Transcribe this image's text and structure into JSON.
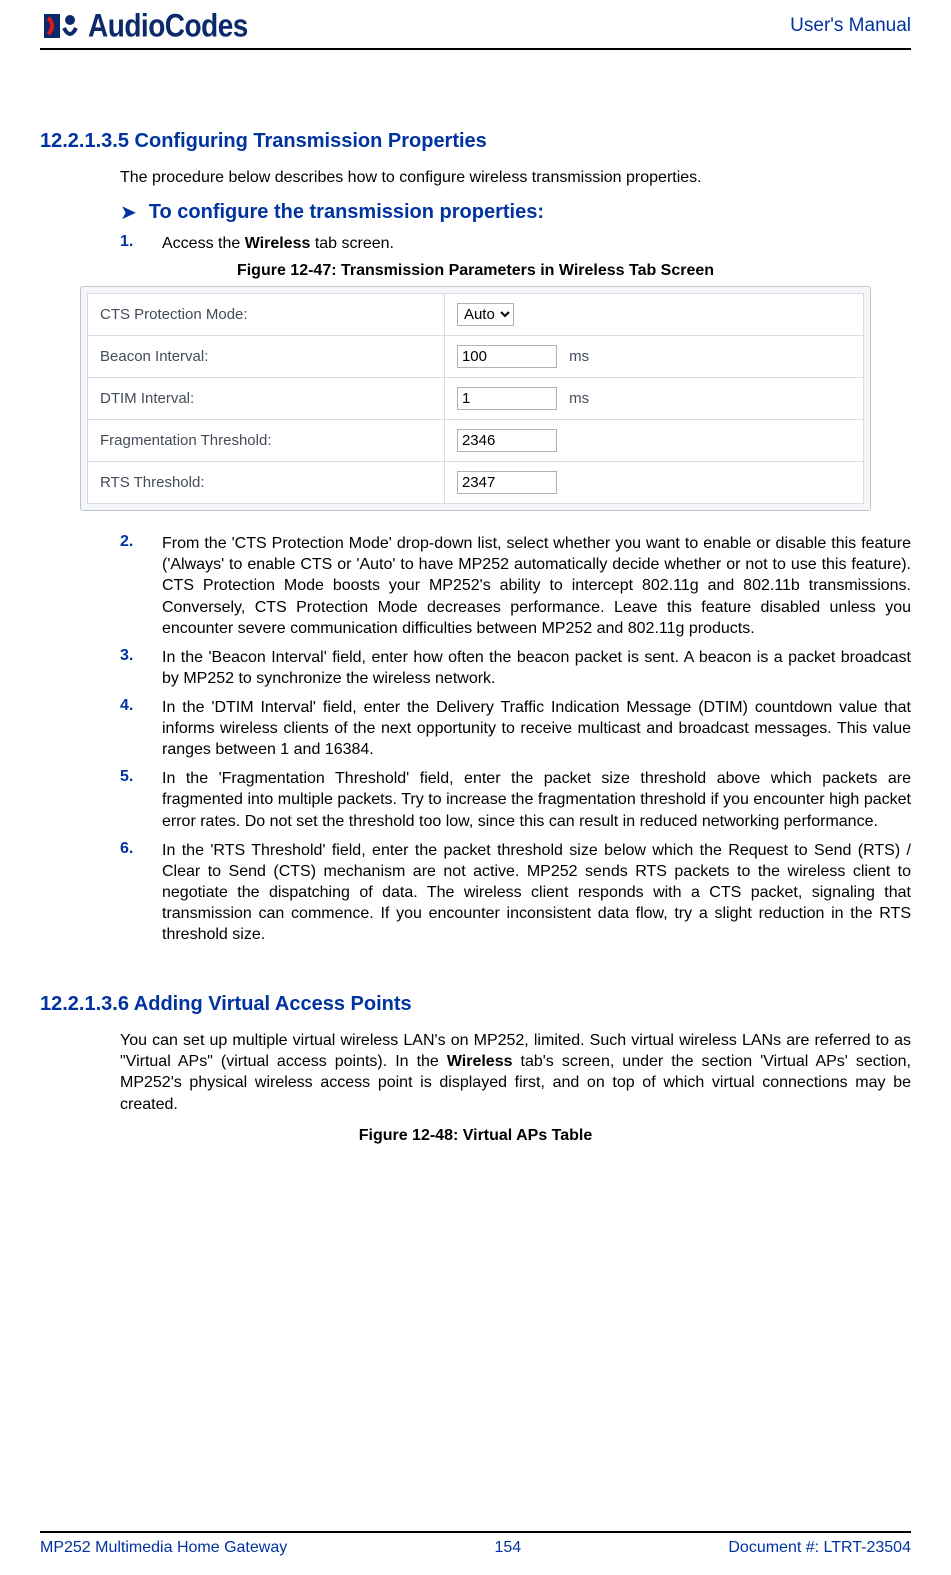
{
  "header": {
    "logo_text": "AudioCodes",
    "right": "User's Manual"
  },
  "section1": {
    "number": "12.2.1.3.5",
    "title": "Configuring Transmission Properties",
    "intro": "The procedure below describes how to configure wireless transmission properties.",
    "proc_heading": "To configure the transmission properties:",
    "figcap": "Figure 12-47: Transmission Parameters in Wireless Tab Screen",
    "step1_pre": "Access the ",
    "step1_bold": "Wireless",
    "step1_post": " tab screen.",
    "step2": "From the 'CTS Protection Mode' drop-down list, select whether you want to enable or disable this feature ('Always' to enable CTS or 'Auto' to have MP252 automatically decide whether or not to use this feature). CTS Protection Mode boosts your MP252's ability to intercept 802.11g and 802.11b transmissions. Conversely, CTS Protection Mode decreases performance. Leave this feature disabled unless you encounter severe communication difficulties between MP252 and 802.11g products.",
    "step3": "In the 'Beacon Interval' field, enter how often the beacon packet is sent. A beacon is a packet broadcast by MP252 to synchronize the wireless network.",
    "step4": "In the 'DTIM Interval' field, enter the Delivery Traffic Indication Message (DTIM) countdown value that informs wireless clients of the next opportunity to receive multicast and broadcast messages. This value ranges between 1 and 16384.",
    "step5": "In the 'Fragmentation Threshold' field, enter the packet size threshold above which packets are fragmented into multiple packets. Try to increase the fragmentation threshold if you encounter high packet error rates. Do not set the threshold too low, since this can result in reduced networking performance.",
    "step6": "In the 'RTS Threshold' field, enter the packet threshold size below which the Request to Send (RTS) / Clear to Send (CTS) mechanism are not active. MP252 sends RTS packets to the wireless client to negotiate the dispatching of data. The wireless client responds with a CTS packet, signaling that transmission can commence. If you encounter inconsistent data flow, try a slight reduction in the RTS threshold size."
  },
  "shot": {
    "rows": {
      "cts": {
        "label": "CTS Protection Mode:",
        "value": "Auto"
      },
      "beac": {
        "label": "Beacon Interval:",
        "value": "100",
        "unit": "ms"
      },
      "dtim": {
        "label": "DTIM Interval:",
        "value": "1",
        "unit": "ms"
      },
      "frag": {
        "label": "Fragmentation Threshold:",
        "value": "2346"
      },
      "rts": {
        "label": "RTS Threshold:",
        "value": "2347"
      }
    }
  },
  "section2": {
    "number": "12.2.1.3.6",
    "title": "Adding Virtual Access Points",
    "para_pre": "You can set up multiple virtual wireless LAN's on MP252, limited. Such virtual wireless LANs are referred to as \"Virtual APs\" (virtual access points). In the ",
    "para_bold": "Wireless",
    "para_post": " tab's screen, under the section 'Virtual APs' section, MP252's physical wireless access point is displayed first, and on top of which virtual connections may be created.",
    "figcap": "Figure 12-48: Virtual APs Table"
  },
  "footer": {
    "left": "MP252 Multimedia Home Gateway",
    "center": "154",
    "right": "Document #: LTRT-23504"
  }
}
